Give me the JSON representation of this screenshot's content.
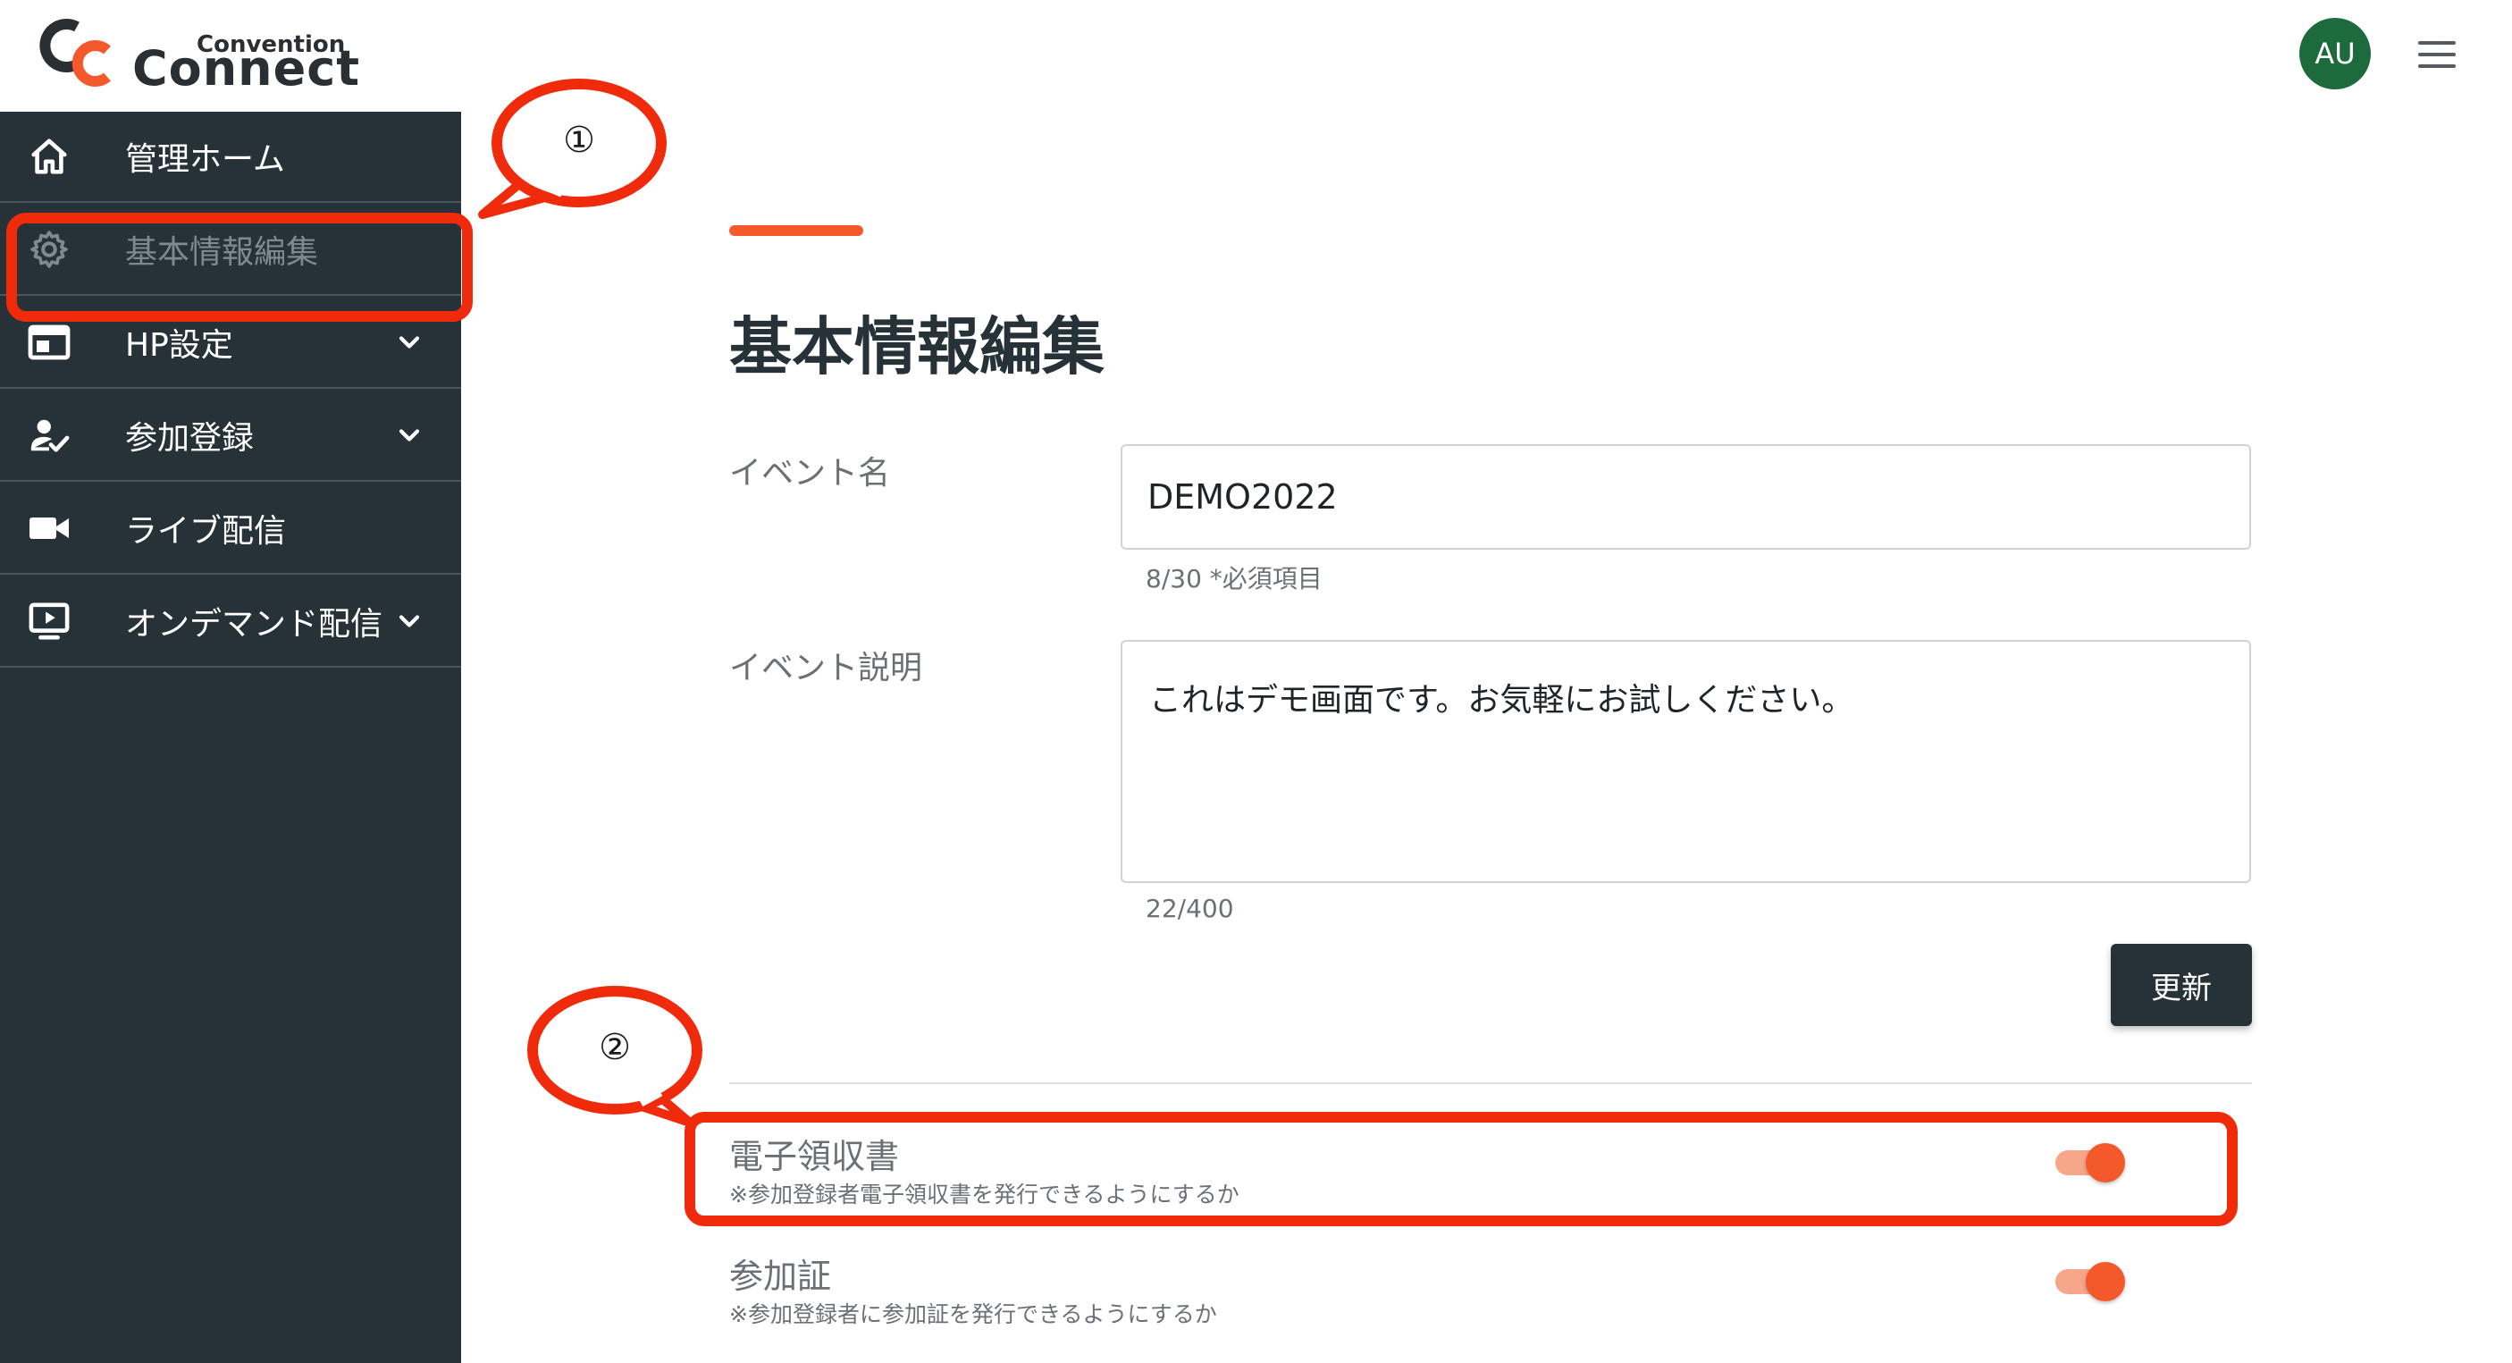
{
  "header": {
    "logo_small": "Convention",
    "logo_big": "Connect",
    "avatar_initials": "AU",
    "brand_dark": "#2a2f33",
    "brand_accent": "#f4592b"
  },
  "sidebar": {
    "items": [
      {
        "label": "管理ホーム",
        "icon": "home-icon",
        "chevron": false,
        "active": false
      },
      {
        "label": "基本情報編集",
        "icon": "gear-icon",
        "chevron": false,
        "active": true
      },
      {
        "label": "HP設定",
        "icon": "web-layout-icon",
        "chevron": true,
        "active": false
      },
      {
        "label": "参加登録",
        "icon": "user-check-icon",
        "chevron": true,
        "active": false
      },
      {
        "label": "ライブ配信",
        "icon": "video-camera-icon",
        "chevron": false,
        "active": false
      },
      {
        "label": "オンデマンド配信",
        "icon": "screen-play-icon",
        "chevron": true,
        "active": false
      }
    ]
  },
  "callouts": {
    "one": "①",
    "two": "②",
    "color": "#f02b0c"
  },
  "main": {
    "title": "基本情報編集",
    "event_name": {
      "label": "イベント名",
      "value": "DEMO2022",
      "helper": "8/30 *必須項目"
    },
    "event_description": {
      "label": "イベント説明",
      "value": "これはデモ画面です。お気軽にお試しください。",
      "helper": "22/400"
    },
    "update_label": "更新",
    "toggles": [
      {
        "title": "電子領収書",
        "description": "※参加登録者電子領収書を発行できるようにするか",
        "on": true
      },
      {
        "title": "参加証",
        "description": "※参加登録者に参加証を発行できるようにするか",
        "on": true
      }
    ]
  }
}
